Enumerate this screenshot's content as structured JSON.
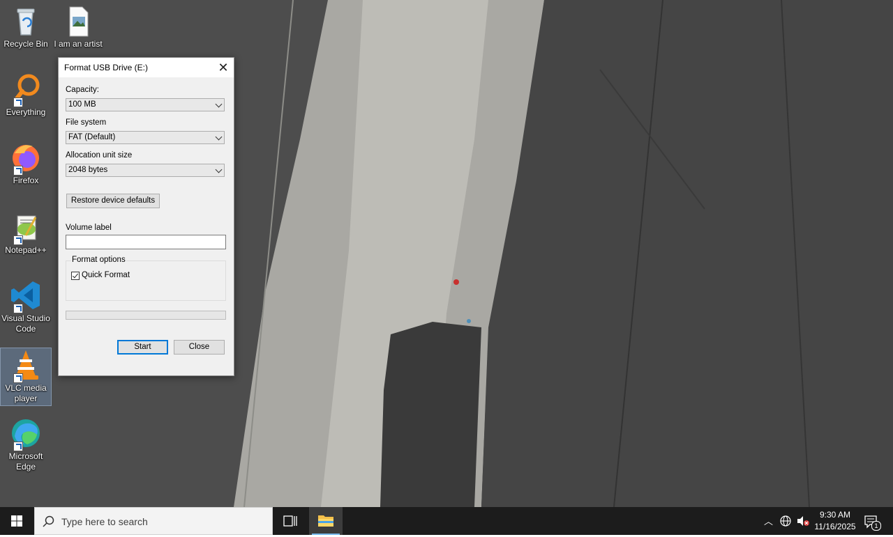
{
  "desktop": {
    "icons": [
      {
        "label": "Recycle Bin",
        "icon": "recycle-bin-icon"
      },
      {
        "label": "I am an artist",
        "icon": "image-file-icon"
      },
      {
        "label": "Everything",
        "icon": "everything-search-icon"
      },
      {
        "label": "Firefox",
        "icon": "firefox-icon"
      },
      {
        "label": "Notepad++",
        "icon": "notepad-plus-plus-icon"
      },
      {
        "label": "Visual Studio Code",
        "icon": "vscode-icon"
      },
      {
        "label": "VLC media player",
        "icon": "vlc-icon"
      },
      {
        "label": "Microsoft Edge",
        "icon": "edge-icon"
      }
    ]
  },
  "dialog": {
    "title": "Format USB Drive (E:)",
    "capacity_label": "Capacity:",
    "capacity_value": "100 MB",
    "filesystem_label": "File system",
    "filesystem_value": "FAT (Default)",
    "allocation_label": "Allocation unit size",
    "allocation_value": "2048 bytes",
    "restore_button": "Restore device defaults",
    "volume_label": "Volume label",
    "volume_value": "",
    "format_options_label": "Format options",
    "quick_format_label": "Quick Format",
    "quick_format_checked": true,
    "progress": 0,
    "start_button": "Start",
    "close_button": "Close"
  },
  "taskbar": {
    "search_placeholder": "Type here to search",
    "time": "9:30 AM",
    "date": "11/16/2025",
    "notification_count": "1",
    "accent_color": "#76b9ed"
  }
}
